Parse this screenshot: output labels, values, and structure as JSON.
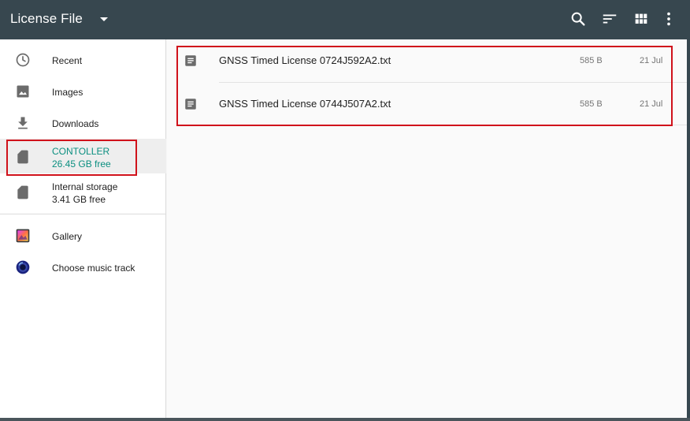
{
  "toolbar": {
    "title": "License File",
    "actions": [
      "search-icon",
      "sort-icon",
      "grid-view-icon",
      "more-vert-icon"
    ]
  },
  "sidebar": {
    "items": [
      {
        "label": "Recent",
        "icon": "clock-icon"
      },
      {
        "label": "Images",
        "icon": "image-icon"
      },
      {
        "label": "Downloads",
        "icon": "download-icon"
      },
      {
        "label": "CONTOLLER",
        "sub": "26.45 GB free",
        "icon": "sd-card-icon",
        "selected": true
      },
      {
        "label": "Internal storage",
        "sub": "3.41 GB free",
        "icon": "sd-card-icon"
      },
      {
        "label": "Gallery",
        "icon": "gallery-app-icon"
      },
      {
        "label": "Choose music track",
        "icon": "music-app-icon"
      }
    ]
  },
  "files": [
    {
      "name": "GNSS Timed License 0724J592A2.txt",
      "size": "585 B",
      "date": "21 Jul",
      "icon": "text-file-icon"
    },
    {
      "name": "GNSS Timed License 0744J507A2.txt",
      "size": "585 B",
      "date": "21 Jul",
      "icon": "text-file-icon"
    }
  ],
  "colors": {
    "toolbar": "#37474f",
    "accent": "#0b8f80",
    "highlight": "#d0121b"
  }
}
